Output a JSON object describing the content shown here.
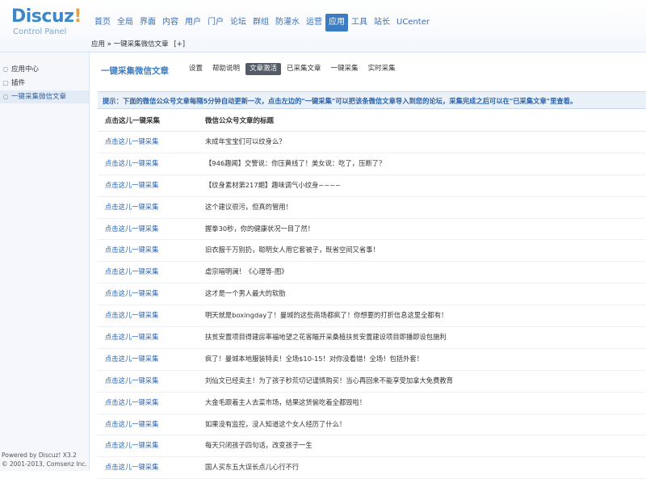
{
  "logo": {
    "main": "Discuz",
    "bang": "!",
    "sub": "Control Panel"
  },
  "topnav": [
    "首页",
    "全局",
    "界面",
    "内容",
    "用户",
    "门户",
    "论坛",
    "群组",
    "防灌水",
    "运营",
    "应用",
    "工具",
    "站长",
    "UCenter"
  ],
  "topnav_active": "应用",
  "breadcrumb": {
    "text": "应用 » 一键采集微信文章",
    "add": "[+]"
  },
  "sidebar": {
    "items": [
      {
        "label": "应用中心",
        "icon": "circle-icon"
      },
      {
        "label": "插件",
        "icon": "square-icon"
      },
      {
        "label": "一键采集微信文章",
        "icon": "circle-icon"
      }
    ]
  },
  "powered": {
    "line1": "Powered by Discuz! X3.2",
    "line2": "© 2001-2013, Comsenz Inc."
  },
  "plugin_title": "一键采集微信文章",
  "subtabs": [
    "设置",
    "帮助说明",
    "文章激活",
    "已采集文章",
    "一键采集",
    "实时采集"
  ],
  "subtab_active": "文章激活",
  "tip": "提示：下面的微信公众号文章每隔5分钟自动更新一次，点击左边的\"一键采集\"可以把该条微信文章导入到您的论坛，采集完成之后可以在\"已采集文章\"里查看。",
  "table": {
    "headers": [
      "点击这儿一键采集",
      "微信公众号文章的标题"
    ],
    "action_label": "点击这儿一键采集",
    "rows": [
      "未成年宝宝们可以纹身么？",
      "【946趣闻】交警说：你压黄线了！美女说：吃了，压断了？",
      "【纹身素材第217期】趣味调气小纹身~~~~",
      "这个建议很污，但真的管用！",
      "握拳30秒，你的健康状况一目了然！",
      "旧衣服千万别扔，聪明女人用它套被子，既省空间又省事！",
      "虐宗暗明澜！《心理等-图》",
      "这才是一个男人最大的软肋",
      "明天就是boxingday了！曼城的这些商场都疯了！你想要的打折信息这里全都有！",
      "扶贫安置项目得建房率福地望之花客瞄开采桑植扶贫安置建设项目即播即设包施利",
      "疯了！曼城本地服装特卖！全场$10-15！对你没看错！全场！包括外套！",
      "刘仙文已经卖主！为了孩子秒荒切记谨慎购买！当心再回来不能享受加拿大免费教育",
      "大金毛跟着主人去菜市场，结果这货偷吃着全都毁啦！",
      "如果没有监控，没人知道这个女人经历了什么！",
      "每天只闭孩子四句话，改变孩子一生",
      "国人买东五大误长点儿心行不行"
    ]
  }
}
